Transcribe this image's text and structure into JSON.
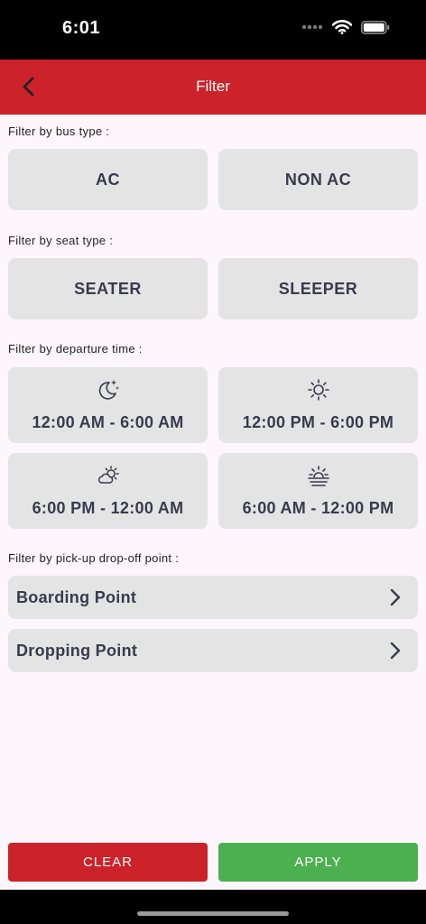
{
  "status": {
    "time": "6:01"
  },
  "header": {
    "title": "Filter"
  },
  "sections": {
    "bus_type": "Filter by bus type :",
    "seat_type": "Filter by seat type :",
    "departure": "Filter by departure time :",
    "points": "Filter by pick-up drop-off point :"
  },
  "bus_types": [
    "AC",
    "NON AC"
  ],
  "seat_types": [
    "SEATER",
    "SLEEPER"
  ],
  "departure_times": [
    {
      "label": "12:00 AM - 6:00 AM",
      "icon": "moon-stars-icon"
    },
    {
      "label": "12:00 PM - 6:00 PM",
      "icon": "sun-icon"
    },
    {
      "label": "6:00 PM - 12:00 AM",
      "icon": "cloud-sun-icon"
    },
    {
      "label": "6:00 AM - 12:00 PM",
      "icon": "sunrise-icon"
    }
  ],
  "points": [
    "Boarding Point",
    "Dropping Point"
  ],
  "buttons": {
    "clear": "CLEAR",
    "apply": "APPLY"
  },
  "colors": {
    "header": "#cc2229",
    "clear": "#cc2229",
    "apply": "#4caf50",
    "chip": "#e4e4e4"
  }
}
